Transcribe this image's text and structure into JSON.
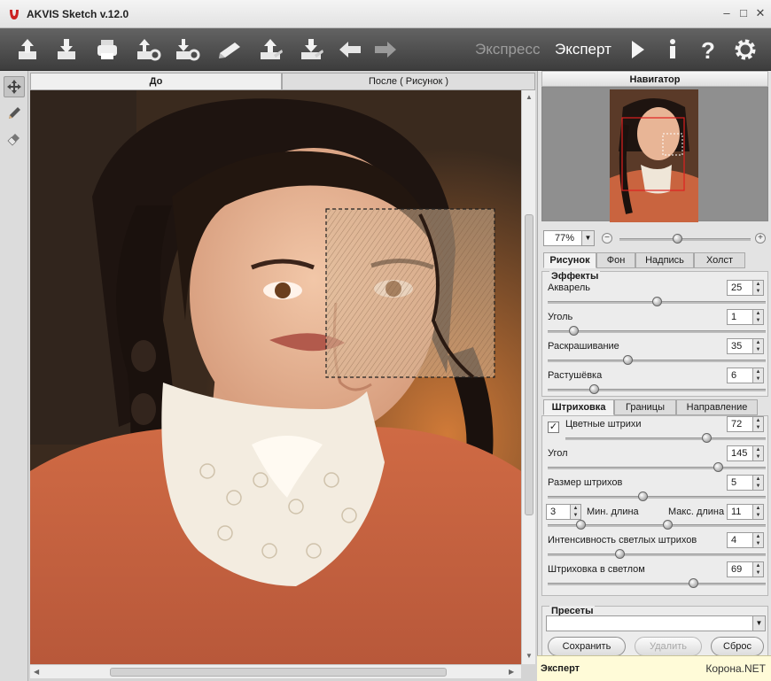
{
  "window": {
    "title": "AKVIS Sketch v.12.0",
    "controls": [
      "minimize",
      "maximize",
      "close"
    ]
  },
  "toolbar": {
    "buttons": [
      "open-icon",
      "save-icon",
      "print-icon",
      "import-settings-icon",
      "export-settings-icon",
      "share-icon",
      "batch-upload-icon",
      "batch-download-icon",
      "undo-arrow-icon",
      "redo-arrow-icon"
    ],
    "mode_express": "Экспресс",
    "mode_expert": "Эксперт",
    "right_icons": [
      "run-icon",
      "info-icon",
      "help-icon",
      "settings-gear-icon"
    ]
  },
  "tools": [
    "navigate-tool-icon",
    "pencil-tool-icon",
    "eraser-tool-icon"
  ],
  "view_tabs": {
    "before": "До",
    "after": "После ( Рисунок )"
  },
  "navigator": {
    "title": "Навигатор",
    "zoom": "77%"
  },
  "settings_tabs": [
    "Рисунок",
    "Фон",
    "Надпись",
    "Холст"
  ],
  "effects": {
    "title": "Эффекты",
    "params": [
      {
        "label": "Акварель",
        "value": "25",
        "level": 0.5
      },
      {
        "label": "Уголь",
        "value": "1",
        "level": 0.1
      },
      {
        "label": "Раскрашивание",
        "value": "35",
        "level": 0.36
      },
      {
        "label": "Растушёвка",
        "value": "6",
        "level": 0.2
      }
    ]
  },
  "hatching_tabs": [
    "Штриховка",
    "Границы",
    "Направление"
  ],
  "hatching": {
    "colored_strokes_label": "Цветные штрихи",
    "colored_strokes_checked": true,
    "colored_strokes_value": "72",
    "angle_label": "Угол",
    "angle_value": "145",
    "stroke_size_label": "Размер штрихов",
    "stroke_size_value": "5",
    "min_length_label": "Мин. длина",
    "min_length_value": "3",
    "max_length_label": "Макс. длина",
    "max_length_value": "11",
    "light_intensity_label": "Интенсивность светлых штрихов",
    "light_intensity_value": "4",
    "light_hatching_label": "Штриховка в светлом",
    "light_hatching_value": "69"
  },
  "presets": {
    "title": "Пресеты",
    "selected": "",
    "save_label": "Сохранить",
    "delete_label": "Удалить",
    "reset_label": "Сброс"
  },
  "status": {
    "text": "Эксперт",
    "watermark": "Корона.NET"
  },
  "colors": {
    "toolbar_bg": "#4a4a4a",
    "status_bg": "#fffbd8",
    "accent_red": "#cc2222"
  }
}
